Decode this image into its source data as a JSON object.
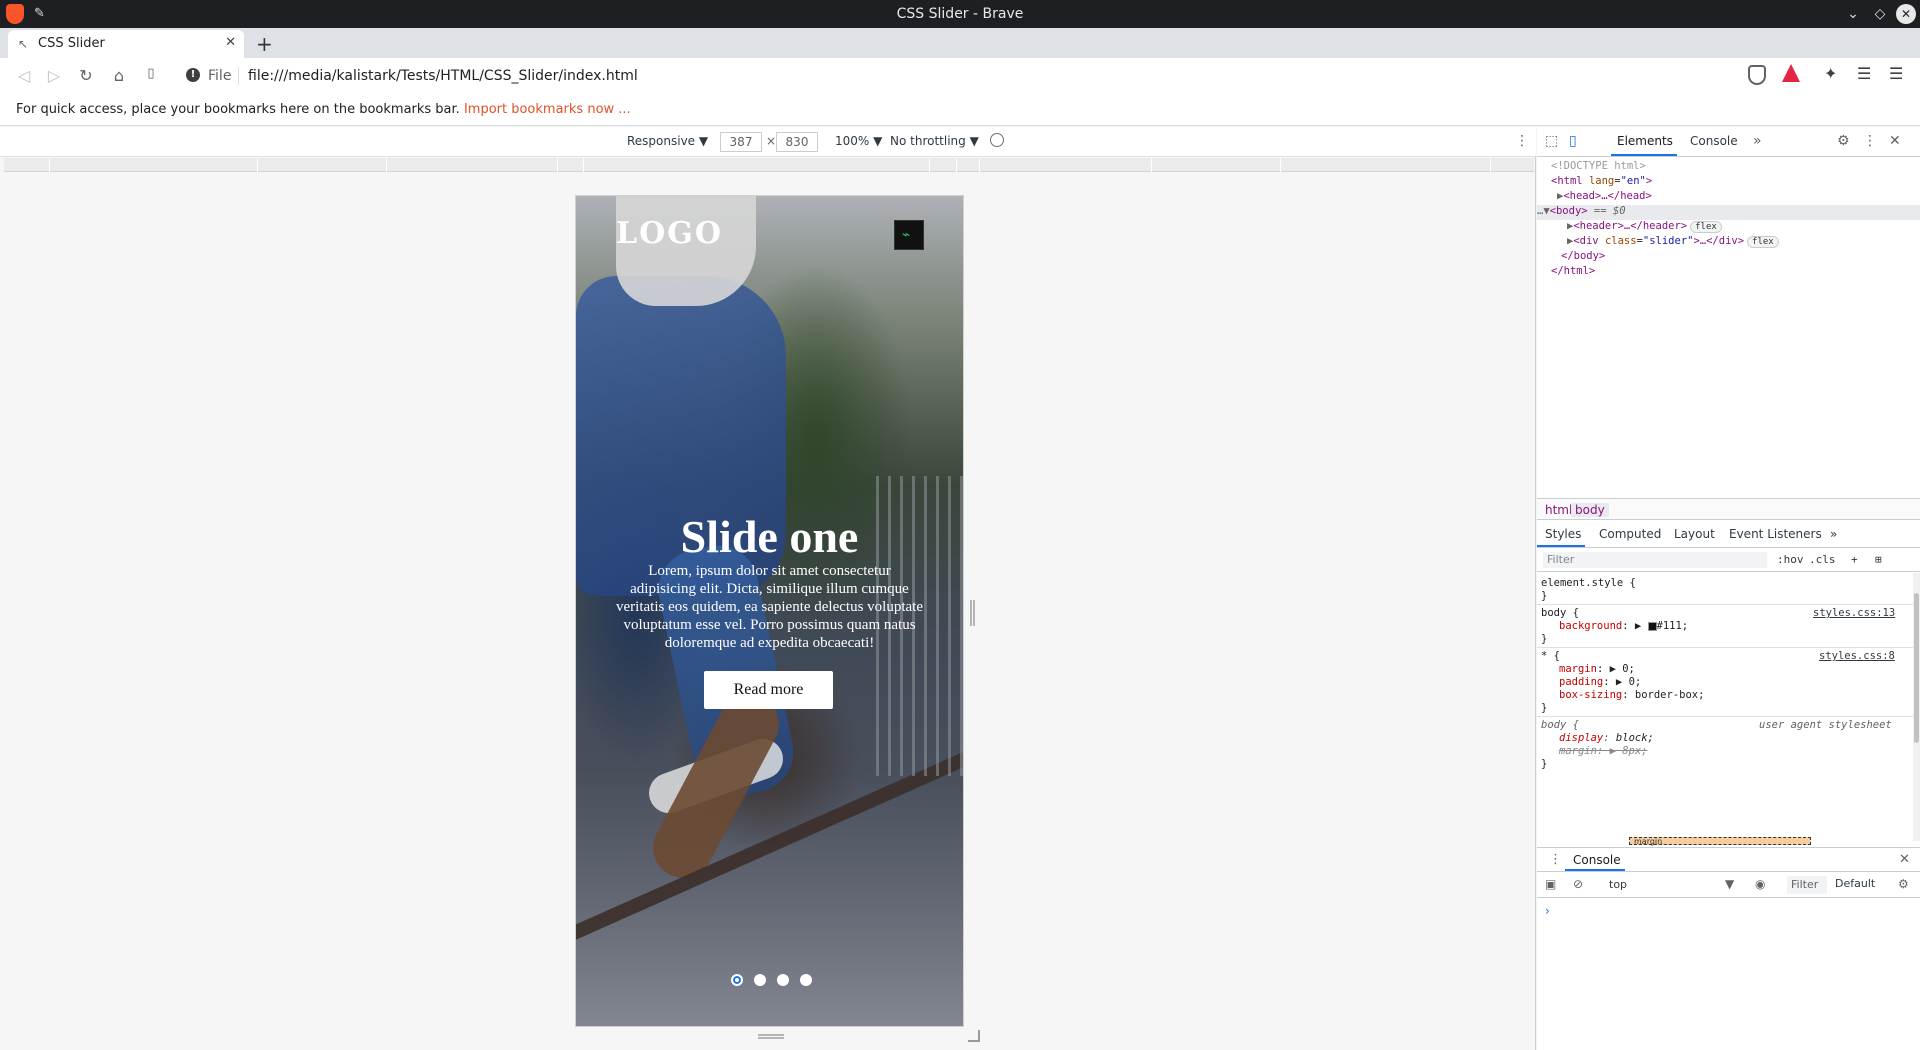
{
  "window": {
    "title": "CSS Slider - Brave",
    "controls": {
      "minimize": "⌄",
      "maximize": "◇",
      "close": "✕"
    }
  },
  "tabs": [
    {
      "title": "CSS Slider",
      "close": "✕"
    }
  ],
  "new_tab": "+",
  "toolbar": {
    "scheme": "File",
    "url": "file:///media/kalistark/Tests/HTML/CSS_Slider/index.html",
    "back": "◁",
    "forward": "▷",
    "reload": "↻",
    "home": "⌂",
    "bookmark": "🔖",
    "extensions": "✦",
    "media": "☰",
    "menu": "☰"
  },
  "bookmarks_bar": {
    "text": "For quick access, place your bookmarks here on the bookmarks bar.",
    "link": "Import bookmarks now ..."
  },
  "device_toolbar": {
    "device": "Responsive ▼",
    "width": "387",
    "height": "830",
    "times": "×",
    "zoom": "100% ▼",
    "throttling": "No throttling ▼",
    "more": "⋮"
  },
  "slider_page": {
    "logo": "LOGO",
    "menu_glyph": "⌁",
    "title": "Slide one",
    "text": "Lorem, ipsum dolor sit amet consectetur adipisicing elit. Dicta, similique illum cumque veritatis eos quidem, ea sapiente delectus voluptate voluptatum esse vel. Porro possimus quam natus doloremque ad expedita obcaecati!",
    "button": "Read more",
    "dots": 4,
    "active_dot": 0
  },
  "devtools": {
    "tabs": [
      "Elements",
      "Console"
    ],
    "more_tabs": "»",
    "icons": {
      "inspect": "⬚",
      "device": "▯",
      "settings": "⚙",
      "kebab": "⋮",
      "close": "✕"
    },
    "dom": {
      "doctype": "<!DOCTYPE html>",
      "html_open": "<html",
      "html_attr": "lang",
      "html_val": "\"en\"",
      "head": "<head>…</head>",
      "body_open": "<body>",
      "body_marker": "== $0",
      "header": "<header>…</header>",
      "div_open": "<div",
      "div_attr": "class",
      "div_val": "\"slider\"",
      "div_close": ">…</div>",
      "body_close": "</body>",
      "html_close": "</html>",
      "flex_badge": "flex",
      "dots": "…"
    },
    "breadcrumbs": [
      "html",
      "body"
    ],
    "styles_tabs": [
      "Styles",
      "Computed",
      "Layout",
      "Event Listeners"
    ],
    "styles_filter_placeholder": "Filter",
    "styles_opts": [
      ":hov",
      ".cls",
      "+"
    ],
    "rules": {
      "element_style": "element.style {",
      "close": "}",
      "body_sel": "body {",
      "body_src": "styles.css:13",
      "bg_prop": "background",
      "bg_val": "#111;",
      "star_sel": "* {",
      "star_src": "styles.css:8",
      "margin_prop": "margin",
      "margin_val": "0;",
      "padding_prop": "padding",
      "padding_val": "0;",
      "boxsizing_prop": "box-sizing",
      "boxsizing_val": "border-box;",
      "ua_sel": "body {",
      "ua_src": "user agent stylesheet",
      "display_prop": "display",
      "display_val": "block;",
      "uamargin_prop": "margin",
      "uamargin_val": "8px;"
    },
    "box_model_label": "margin",
    "console": {
      "title": "Console",
      "context": "top",
      "filter": "Filter",
      "levels": "Default",
      "prompt": "›"
    }
  }
}
